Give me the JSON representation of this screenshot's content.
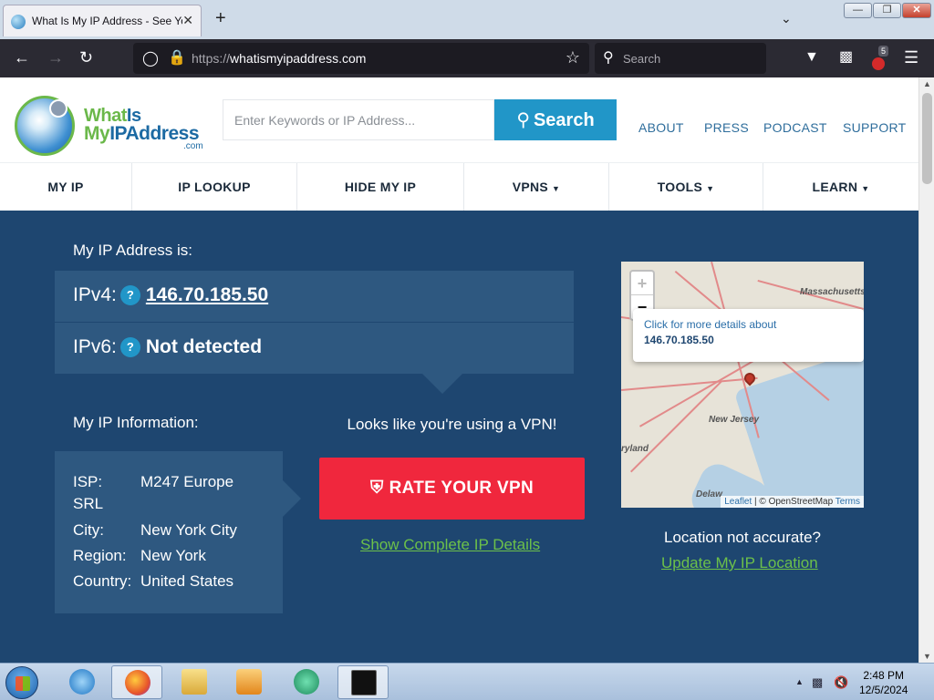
{
  "browser": {
    "tab_title": "What Is My IP Address - See Your",
    "tab_close": "✕",
    "new_tab": "+",
    "url_protocol": "https://",
    "url_host": "whatismyipaddress.com",
    "search_placeholder": "Search",
    "extension_badge": "5",
    "window_buttons": {
      "minimize": "—",
      "maximize": "❐",
      "close": "✕"
    }
  },
  "site": {
    "logo": {
      "line1_a": "What",
      "line1_b": "Is",
      "line2_a": "My",
      "line2_b": "IP",
      "line2_c": "Address",
      "line3": ".com"
    },
    "search": {
      "placeholder": "Enter Keywords or IP Address...",
      "button": "Search"
    },
    "top_links": [
      "ABOUT",
      "PRESS",
      "PODCAST",
      "SUPPORT"
    ],
    "nav": [
      {
        "label": "MY IP",
        "caret": ""
      },
      {
        "label": "IP LOOKUP",
        "caret": ""
      },
      {
        "label": "HIDE MY IP",
        "caret": ""
      },
      {
        "label": "VPNS",
        "caret": "▼"
      },
      {
        "label": "TOOLS",
        "caret": "▼"
      },
      {
        "label": "LEARN",
        "caret": "▼"
      }
    ]
  },
  "hero": {
    "my_ip_label": "My IP Address is:",
    "ipv4_label": "IPv4:",
    "ipv4_value": "146.70.185.50",
    "ipv6_label": "IPv6:",
    "ipv6_value": "Not detected",
    "help_mark": "?",
    "info_title": "My IP Information:",
    "info": {
      "isp_key": "ISP:",
      "isp_val_1": "M247 Europe",
      "isp_val_2": "SRL",
      "city_key": "City:",
      "city_val": "New York City",
      "region_key": "Region:",
      "region_val": "New York",
      "country_key": "Country:",
      "country_val": "United States"
    },
    "vpn_text": "Looks like you're using a VPN!",
    "rate_button": "RATE YOUR VPN",
    "details_link": "Show Complete IP Details",
    "map": {
      "zoom_in": "+",
      "zoom_out": "−",
      "popup_line1": "Click for more details about",
      "popup_line2": "146.70.185.50",
      "label_massachusetts": "Massachusetts",
      "label_newjersey": "New Jersey",
      "label_maryland": "ryland",
      "label_delaware": "Delaw",
      "attrib_leaflet": "Leaflet",
      "attrib_sep": " | © OpenStreetMap ",
      "attrib_terms": "Terms"
    },
    "loc_text": "Location not accurate?",
    "update_link": "Update My IP Location"
  },
  "taskbar": {
    "time": "2:48 PM",
    "date": "12/5/2024"
  },
  "colors": {
    "hero_bg": "#1e4670",
    "panel_bg": "#2e5880",
    "accent_blue": "#2196c8",
    "rate_red": "#f0273d",
    "link_green": "#6cc04a"
  }
}
